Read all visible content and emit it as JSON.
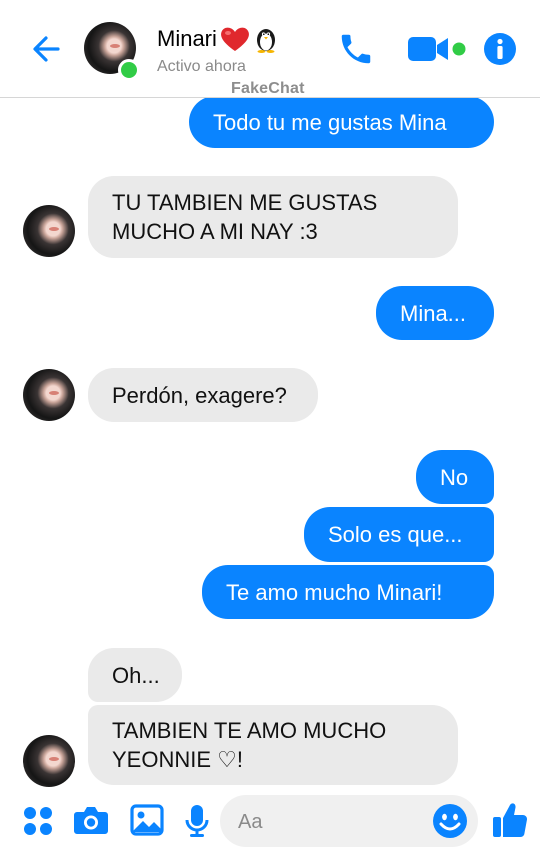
{
  "header": {
    "contact_name": "Minari",
    "status": "Activo ahora",
    "watermark": "FakeChat"
  },
  "messages": [
    {
      "direction": "outgoing",
      "text": "Todo tu me gustas Mina"
    },
    {
      "direction": "incoming",
      "lines": [
        "TU TAMBIEN ME GUSTAS",
        "MUCHO A MI NAY :3"
      ]
    },
    {
      "direction": "outgoing",
      "text": "Mina..."
    },
    {
      "direction": "incoming",
      "text": "Perdón, exagere?"
    },
    {
      "direction": "outgoing",
      "text": "No"
    },
    {
      "direction": "outgoing",
      "text": "Solo es que..."
    },
    {
      "direction": "outgoing",
      "text": "Te amo mucho Minari!"
    },
    {
      "direction": "incoming",
      "text": "Oh..."
    },
    {
      "direction": "incoming",
      "lines": [
        "TAMBIEN TE AMO MUCHO",
        "YEONNIE ♡!"
      ]
    }
  ],
  "composer": {
    "placeholder": "Aa"
  },
  "colors": {
    "accent": "#0a84ff",
    "incoming_bubble": "#eaeaea",
    "online": "#31cc46"
  },
  "icons": {
    "back": "arrow-left-icon",
    "call": "phone-icon",
    "video": "video-camera-icon",
    "info": "info-icon",
    "apps": "four-dots-icon",
    "camera": "camera-icon",
    "gallery": "image-icon",
    "voice": "microphone-icon",
    "emoji": "smiley-icon",
    "like": "thumbs-up-icon"
  }
}
